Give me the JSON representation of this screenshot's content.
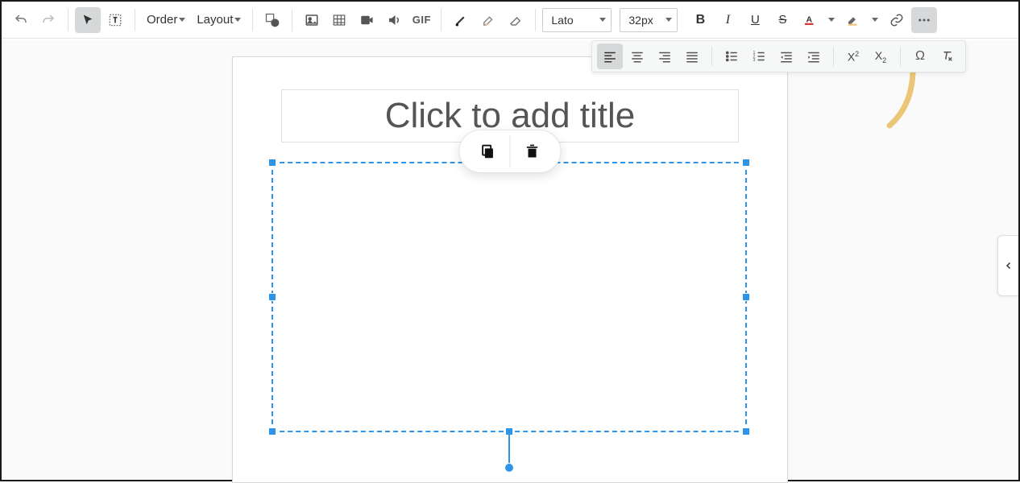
{
  "toolbar": {
    "order_label": "Order",
    "layout_label": "Layout",
    "gif_label": "GIF",
    "font_family": "Lato",
    "font_size": "32px"
  },
  "slide": {
    "title_placeholder": "Click to add title"
  },
  "icons": {
    "undo": "undo-icon",
    "redo": "redo-icon",
    "select": "cursor-icon",
    "text": "text-cursor-icon",
    "shape": "shape-icon",
    "image": "image-icon",
    "crop": "image-crop-icon",
    "video": "video-icon",
    "audio": "audio-icon",
    "pen": "pen-icon",
    "eraser_small": "eraser-small-icon",
    "eraser": "eraser-large-icon",
    "bold": "bold-icon",
    "italic": "italic-icon",
    "underline": "underline-icon",
    "strike": "strike-icon",
    "text_color": "text-color-icon",
    "text_color_caret": "caret-icon",
    "highlight": "highlight-icon",
    "highlight_caret": "caret-icon",
    "link": "link-icon",
    "more": "more-icon",
    "align_left": "align-left-icon",
    "align_center": "align-center-icon",
    "align_right": "align-right-icon",
    "align_justify": "align-justify-icon",
    "list_bullet": "bullet-list-icon",
    "list_number": "number-list-icon",
    "outdent": "outdent-icon",
    "indent": "indent-icon",
    "superscript": "superscript-icon",
    "subscript": "subscript-icon",
    "omega": "special-char-icon",
    "clear_format": "clear-format-icon",
    "copy": "copy-icon",
    "trash": "trash-icon",
    "chevron_left": "chevron-left-icon"
  }
}
